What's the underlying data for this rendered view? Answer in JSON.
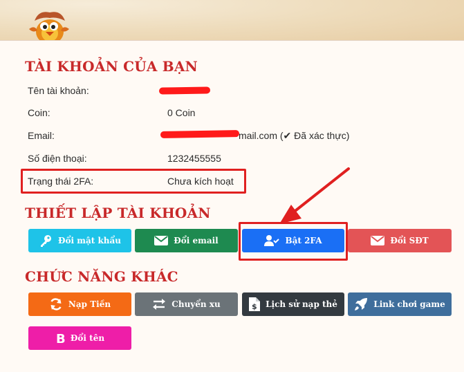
{
  "account_section": {
    "title": "TÀI KHOẢN CỦA BẠN",
    "rows": [
      {
        "label": "Tên tài khoản:",
        "value": ""
      },
      {
        "label": "Coin:",
        "value": "0 Coin"
      },
      {
        "label": "Email:",
        "value": "mail.com (✔ Đã xác thực)"
      },
      {
        "label": "Số điện thoại:",
        "value": "1232455555"
      },
      {
        "label": "Trạng thái 2FA:",
        "value": "Chưa kích hoạt"
      }
    ]
  },
  "settings_section": {
    "title": "THIẾT LẬP TÀI KHOẢN",
    "buttons": [
      {
        "label": "Đổi mật khẩu",
        "icon": "key-icon",
        "color": "#1ec3e8"
      },
      {
        "label": "Đổi email",
        "icon": "envelope-icon",
        "color": "#1e8a50"
      },
      {
        "label": "Bật 2FA",
        "icon": "user-check-icon",
        "color": "#1a6ff5"
      },
      {
        "label": "Đổi SĐT",
        "icon": "envelope-icon",
        "color": "#e35456"
      }
    ]
  },
  "other_section": {
    "title": "CHỨC NĂNG KHÁC",
    "buttons": [
      {
        "label": "Nạp Tiền",
        "icon": "refresh-icon",
        "color": "#f46a15"
      },
      {
        "label": "Chuyển xu",
        "icon": "exchange-icon",
        "color": "#6b7378"
      },
      {
        "label": "Lịch sử nạp thẻ",
        "icon": "file-dollar-icon",
        "color": "#333a40"
      },
      {
        "label": "Link chơi game",
        "icon": "rocket-icon",
        "color": "#3f6e9c"
      },
      {
        "label": "Đổi tên",
        "icon": "bold-b-icon",
        "color": "#ee1ea8"
      }
    ]
  },
  "colors": {
    "title_red": "#c8292a",
    "annotation_red": "#e02020",
    "panel_bg": "#fffaf5"
  }
}
